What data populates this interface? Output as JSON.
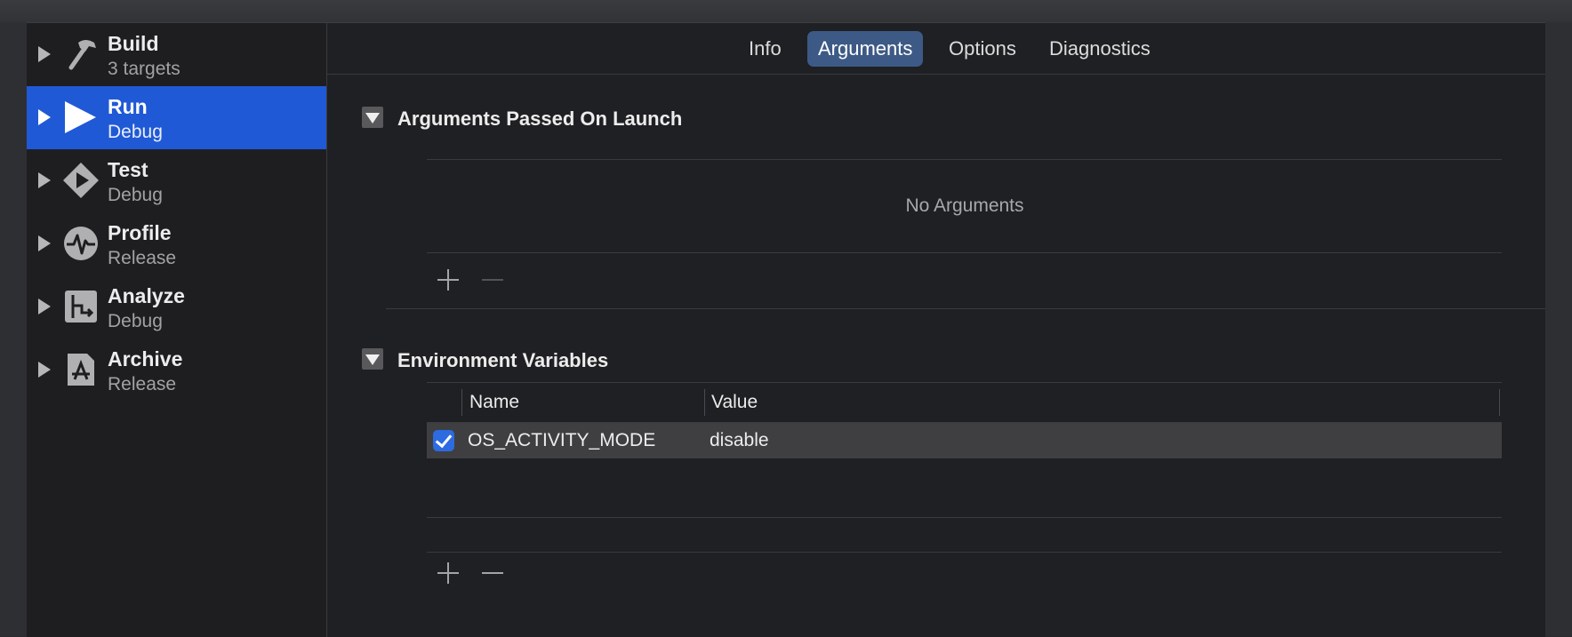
{
  "sidebar": {
    "items": [
      {
        "title": "Build",
        "subtitle": "3 targets",
        "icon": "hammer-icon",
        "selected": false
      },
      {
        "title": "Run",
        "subtitle": "Debug",
        "icon": "play-icon",
        "selected": true
      },
      {
        "title": "Test",
        "subtitle": "Debug",
        "icon": "test-diamond-icon",
        "selected": false
      },
      {
        "title": "Profile",
        "subtitle": "Release",
        "icon": "waveform-gauge-icon",
        "selected": false
      },
      {
        "title": "Analyze",
        "subtitle": "Debug",
        "icon": "analyze-branch-icon",
        "selected": false
      },
      {
        "title": "Archive",
        "subtitle": "Release",
        "icon": "archive-app-icon",
        "selected": false
      }
    ]
  },
  "tabs": [
    {
      "label": "Info",
      "active": false
    },
    {
      "label": "Arguments",
      "active": true
    },
    {
      "label": "Options",
      "active": false
    },
    {
      "label": "Diagnostics",
      "active": false
    }
  ],
  "arguments_section": {
    "title": "Arguments Passed On Launch",
    "empty_message": "No Arguments"
  },
  "env_section": {
    "title": "Environment Variables",
    "columns": {
      "name": "Name",
      "value": "Value"
    },
    "rows": [
      {
        "enabled": true,
        "name": "OS_ACTIVITY_MODE",
        "value": "disable"
      }
    ]
  },
  "colors": {
    "selection": "#2059d6",
    "active_tab": "#3d5a86",
    "checkbox": "#2d6be0",
    "background": "#1f2023"
  }
}
